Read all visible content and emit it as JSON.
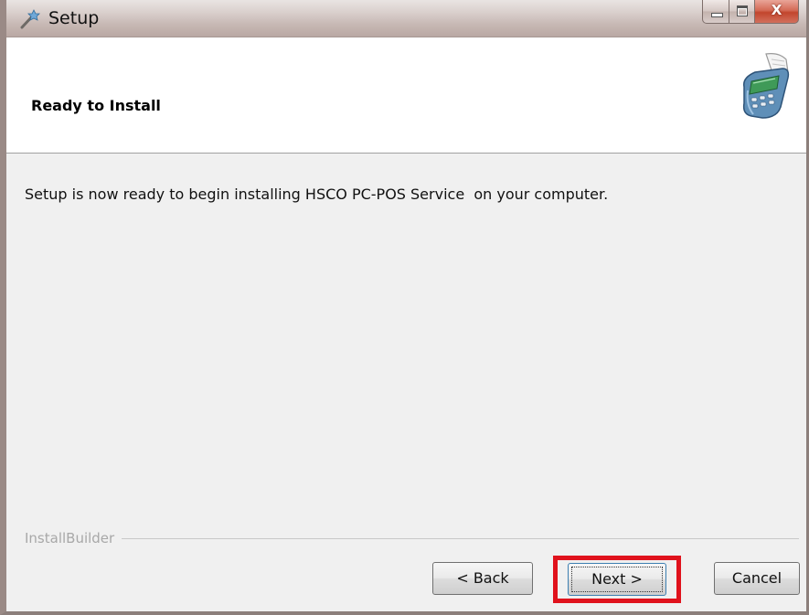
{
  "window": {
    "title": "Setup",
    "app_icon": "setup-wand-icon",
    "controls": {
      "minimize": "minimize-icon",
      "maximize": "maximize-icon",
      "close": "close-icon",
      "close_glyph": "X"
    }
  },
  "header": {
    "title": "Ready to Install",
    "icon": "pos-terminal-icon"
  },
  "body": {
    "message": "Setup is now ready to begin installing HSCO PC-POS Service  on your computer."
  },
  "footer": {
    "brand": "InstallBuilder",
    "buttons": {
      "back": "< Back",
      "next": "Next >",
      "cancel": "Cancel"
    },
    "highlight_color": "#e0121c"
  }
}
